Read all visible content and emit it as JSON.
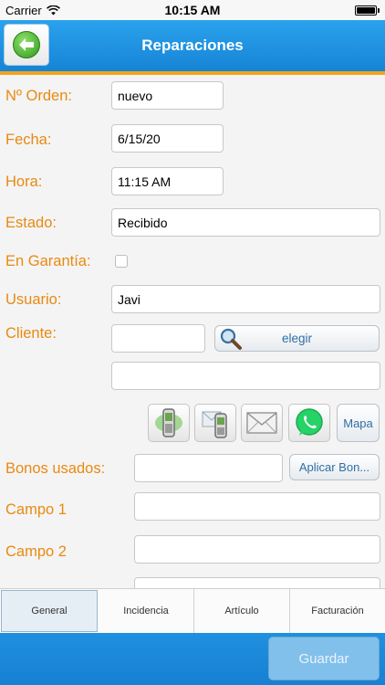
{
  "status": {
    "carrier": "Carrier",
    "time": "10:15 AM"
  },
  "nav": {
    "title": "Reparaciones"
  },
  "form": {
    "orden_label": "Nº Orden:",
    "orden_value": "nuevo",
    "fecha_label": "Fecha:",
    "fecha_value": "6/15/20",
    "hora_label": "Hora:",
    "hora_value": "11:15 AM",
    "estado_label": "Estado:",
    "estado_value": "Recibido",
    "garantia_label": "En Garantía:",
    "usuario_label": "Usuario:",
    "usuario_value": "Javi",
    "cliente_label": "Cliente:",
    "cliente_value": "",
    "elegir_label": "elegir",
    "cliente_detail_value": "",
    "mapa_label": "Mapa",
    "bonos_label": "Bonos usados:",
    "bonos_value": "",
    "aplicar_label": "Aplicar Bon...",
    "campo1_label": "Campo 1",
    "campo1_value": "",
    "campo2_label": "Campo 2",
    "campo2_value": ""
  },
  "tabs": [
    {
      "label": "General"
    },
    {
      "label": "Incidencia"
    },
    {
      "label": "Artículo"
    },
    {
      "label": "Facturación"
    }
  ],
  "footer": {
    "save_label": "Guardar"
  },
  "colors": {
    "accent_orange": "#e88a12",
    "nav_blue": "#1d8fe0",
    "whatsapp_green": "#25d366"
  },
  "icons": [
    "wifi-icon",
    "battery-icon",
    "back-arrow-icon",
    "search-icon",
    "phone-call-icon",
    "sms-icon",
    "email-icon",
    "whatsapp-icon"
  ]
}
